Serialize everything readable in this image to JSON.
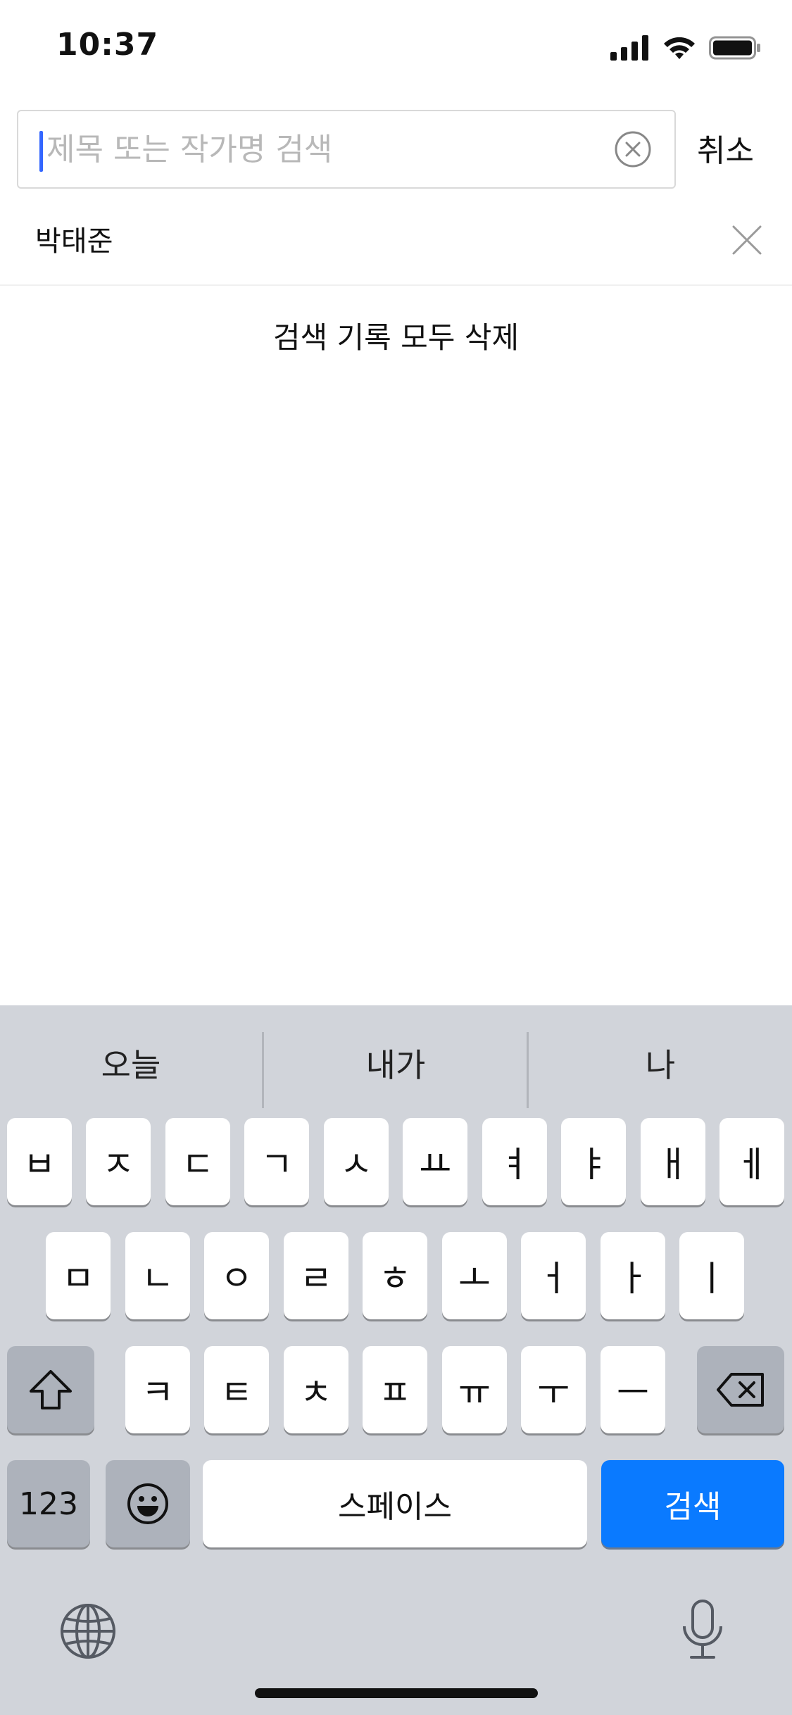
{
  "status_bar": {
    "time": "10:37",
    "battery_level": 1.0
  },
  "search": {
    "placeholder": "제목 또는 작가명 검색",
    "value": "",
    "cancel_label": "취소"
  },
  "history": {
    "items": [
      {
        "label": "박태준"
      }
    ],
    "delete_all_label": "검색 기록 모두 삭제"
  },
  "keyboard": {
    "suggestions": [
      "오늘",
      "내가",
      "나"
    ],
    "row1": [
      "ㅂ",
      "ㅈ",
      "ㄷ",
      "ㄱ",
      "ㅅ",
      "ㅛ",
      "ㅕ",
      "ㅑ",
      "ㅐ",
      "ㅔ"
    ],
    "row2": [
      "ㅁ",
      "ㄴ",
      "ㅇ",
      "ㄹ",
      "ㅎ",
      "ㅗ",
      "ㅓ",
      "ㅏ",
      "ㅣ"
    ],
    "row3": [
      "ㅋ",
      "ㅌ",
      "ㅊ",
      "ㅍ",
      "ㅠ",
      "ㅜ",
      "ㅡ"
    ],
    "numbers_label": "123",
    "space_label": "스페이스",
    "return_label": "검색",
    "colors": {
      "background": "#d1d4da",
      "key": "#ffffff",
      "dark_key": "#adb2bb",
      "return_key": "#0a7aff"
    }
  },
  "colors": {
    "caret": "#3366ff",
    "placeholder": "#b8b8b8"
  }
}
